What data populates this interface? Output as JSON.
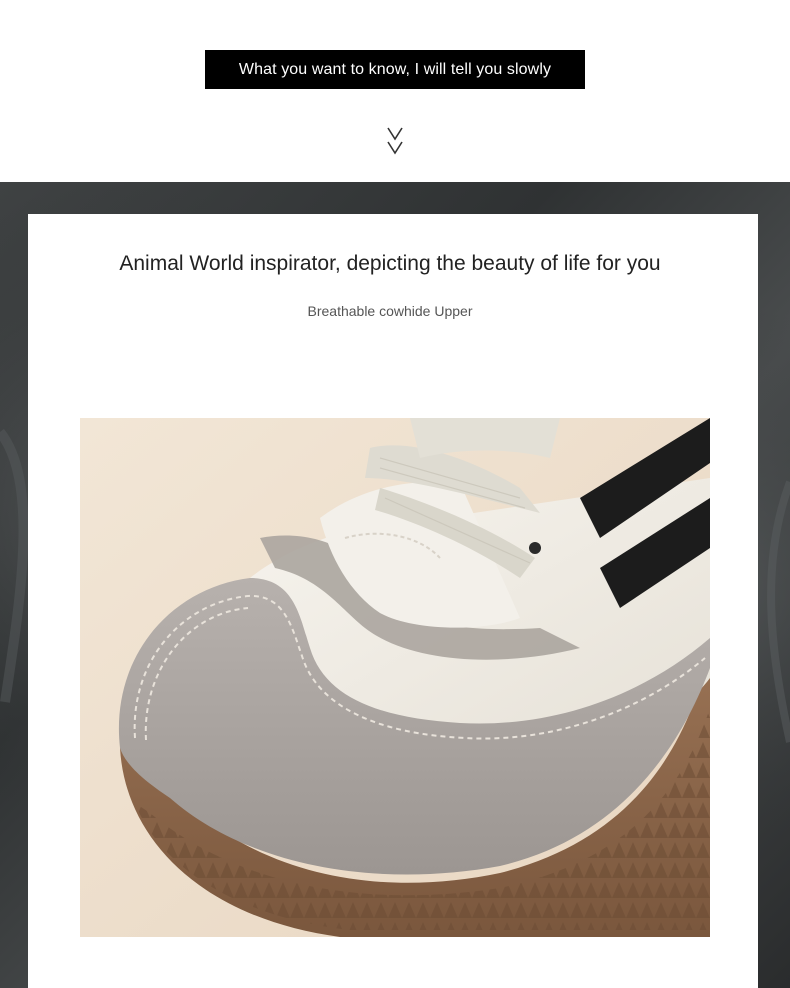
{
  "banner": {
    "text": "What you want to know, I will tell you slowly"
  },
  "icons": {
    "scroll_hint": "double-chevron-down-icon",
    "product": "sneaker-toe-photo"
  },
  "section": {
    "headline": "Animal World inspirator, depicting the beauty of life for you",
    "subline": "Breathable cowhide Upper"
  },
  "colors": {
    "banner_bg": "#000000",
    "banner_text": "#ffffff",
    "frame": "#3a3d3e",
    "card": "#ffffff",
    "photo_bg": "#efe1cf",
    "suede": "#a9a39f",
    "leather": "#f1ede4",
    "stripe": "#1e1e1e",
    "gum_sole": "#8b6548"
  }
}
